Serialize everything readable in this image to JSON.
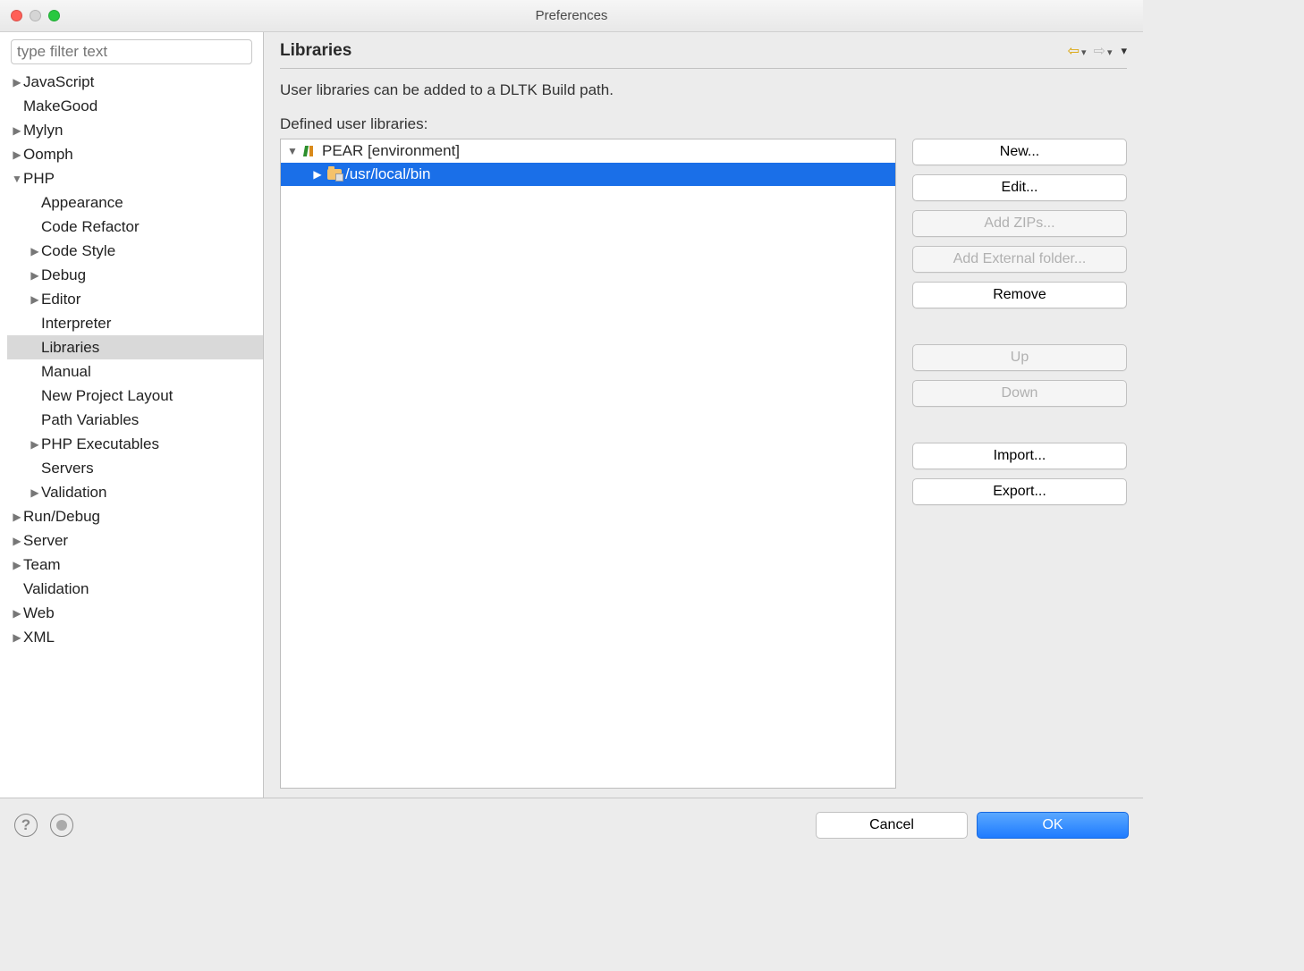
{
  "window": {
    "title": "Preferences"
  },
  "sidebar": {
    "filter_placeholder": "type filter text",
    "items": [
      {
        "label": "JavaScript",
        "expandable": true,
        "expanded": false,
        "indent": 0
      },
      {
        "label": "MakeGood",
        "expandable": false,
        "indent": 0
      },
      {
        "label": "Mylyn",
        "expandable": true,
        "expanded": false,
        "indent": 0
      },
      {
        "label": "Oomph",
        "expandable": true,
        "expanded": false,
        "indent": 0
      },
      {
        "label": "PHP",
        "expandable": true,
        "expanded": true,
        "indent": 0
      },
      {
        "label": "Appearance",
        "expandable": false,
        "indent": 1
      },
      {
        "label": "Code Refactor",
        "expandable": false,
        "indent": 1
      },
      {
        "label": "Code Style",
        "expandable": true,
        "expanded": false,
        "indent": 1
      },
      {
        "label": "Debug",
        "expandable": true,
        "expanded": false,
        "indent": 1
      },
      {
        "label": "Editor",
        "expandable": true,
        "expanded": false,
        "indent": 1
      },
      {
        "label": "Interpreter",
        "expandable": false,
        "indent": 1
      },
      {
        "label": "Libraries",
        "expandable": false,
        "indent": 1,
        "selected": true
      },
      {
        "label": "Manual",
        "expandable": false,
        "indent": 1
      },
      {
        "label": "New Project Layout",
        "expandable": false,
        "indent": 1
      },
      {
        "label": "Path Variables",
        "expandable": false,
        "indent": 1
      },
      {
        "label": "PHP Executables",
        "expandable": true,
        "expanded": false,
        "indent": 1
      },
      {
        "label": "Servers",
        "expandable": false,
        "indent": 1
      },
      {
        "label": "Validation",
        "expandable": true,
        "expanded": false,
        "indent": 1
      },
      {
        "label": "Run/Debug",
        "expandable": true,
        "expanded": false,
        "indent": 0
      },
      {
        "label": "Server",
        "expandable": true,
        "expanded": false,
        "indent": 0
      },
      {
        "label": "Team",
        "expandable": true,
        "expanded": false,
        "indent": 0
      },
      {
        "label": "Validation",
        "expandable": false,
        "indent": 0
      },
      {
        "label": "Web",
        "expandable": true,
        "expanded": false,
        "indent": 0
      },
      {
        "label": "XML",
        "expandable": true,
        "expanded": false,
        "indent": 0
      }
    ]
  },
  "main": {
    "heading": "Libraries",
    "description": "User libraries can be added to a DLTK Build path.",
    "list_label": "Defined user libraries:",
    "library_tree": [
      {
        "label": "PEAR [environment]",
        "expanded": true,
        "icon": "books",
        "indent": 0,
        "selected": false
      },
      {
        "label": "/usr/local/bin",
        "expanded": false,
        "icon": "folder",
        "indent": 1,
        "selected": true
      }
    ],
    "buttons": {
      "new": "New...",
      "edit": "Edit...",
      "add_zips": "Add ZIPs...",
      "add_external": "Add External folder...",
      "remove": "Remove",
      "up": "Up",
      "down": "Down",
      "import": "Import...",
      "export": "Export..."
    }
  },
  "footer": {
    "cancel": "Cancel",
    "ok": "OK"
  }
}
